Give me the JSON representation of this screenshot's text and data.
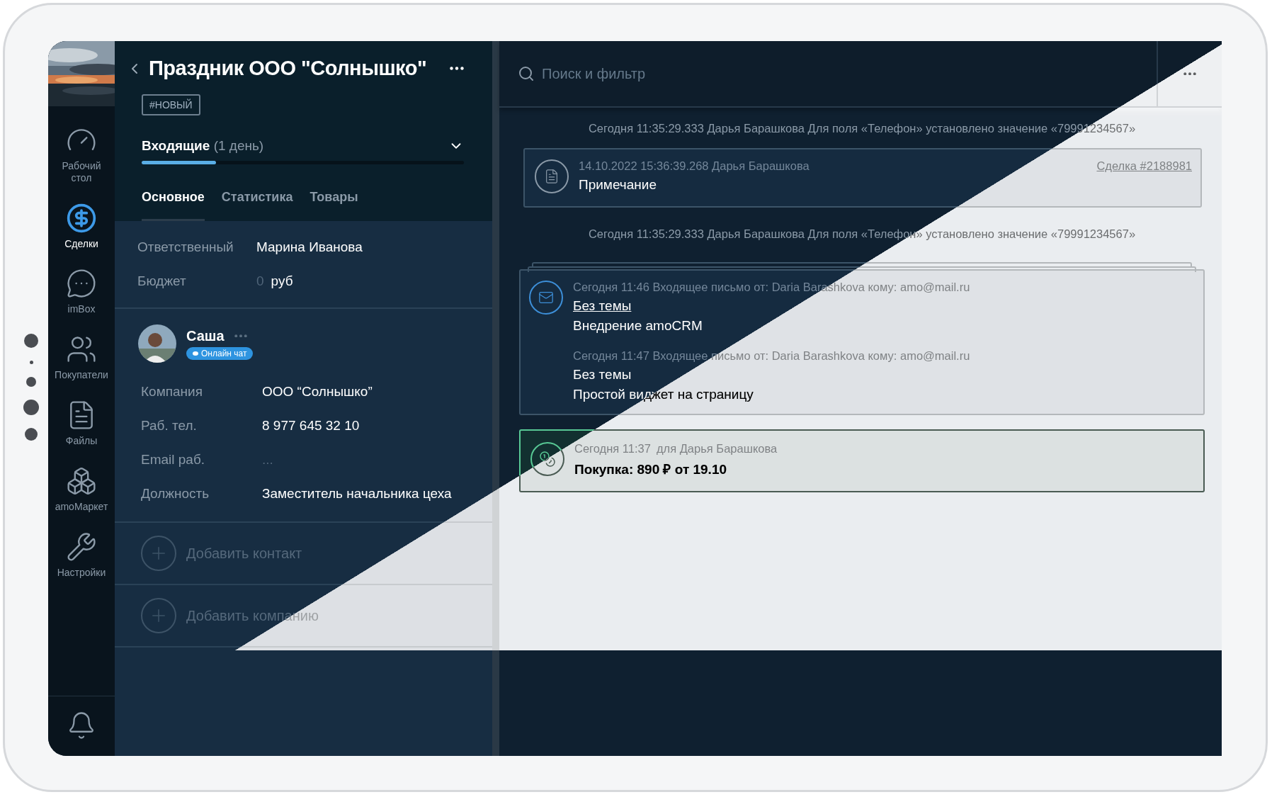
{
  "sidebar": {
    "items": [
      {
        "label": "Рабочий стол",
        "kind": "gauge",
        "selected": false
      },
      {
        "label": "Сделки",
        "kind": "deals",
        "selected": true
      },
      {
        "label": "imBox",
        "kind": "chat",
        "selected": false
      },
      {
        "label": "Покупатели",
        "kind": "customers",
        "selected": false
      },
      {
        "label": "Файлы",
        "kind": "files",
        "selected": false
      },
      {
        "label": "amoМаркет",
        "kind": "market",
        "selected": false
      },
      {
        "label": "Настройки",
        "kind": "settings",
        "selected": false
      }
    ]
  },
  "lead": {
    "title": "Праздник ООО \"Солнышко\"",
    "tag": "#НОВЫЙ",
    "pipeline": {
      "stage": "Входящие",
      "duration": "(1 день)",
      "level": 0.23
    },
    "tabs": [
      {
        "label": "Основное",
        "selected": true
      },
      {
        "label": "Статистика",
        "selected": false
      },
      {
        "label": "Товары",
        "selected": false
      }
    ],
    "fields": [
      {
        "label": "Ответственный",
        "value": "Марина Иванова",
        "kind": "text"
      },
      {
        "label": "Бюджет",
        "value": "0",
        "unit": "руб",
        "kind": "money"
      }
    ]
  },
  "contact": {
    "name": "Саша",
    "badge": "Онлайн чат",
    "fields": [
      {
        "label": "Компания",
        "value": "ООО “Солнышко”",
        "kind": "text"
      },
      {
        "label": "Раб. тел.",
        "value": "8 977 645 32 10",
        "kind": "text"
      },
      {
        "label": "Email раб.",
        "value": "...",
        "kind": "empty"
      },
      {
        "label": "Должность",
        "value": "Заместитель начальника цеха",
        "kind": "text"
      }
    ]
  },
  "add_actions": [
    "Добавить контакт",
    "Добавить компанию"
  ],
  "feed": {
    "search": {
      "placeholder": "Поиск и фильтр"
    },
    "events": [
      {
        "kind": "system",
        "text": "Сегодня 11:35:29.333 Дарья Барашкова Для поля «Телефон» установлено значение «79991234567»"
      },
      {
        "kind": "note",
        "meta": "14.10.2022 15:36:39.268 Дарья Барашкова",
        "link": "Сделка #2188981",
        "text": "Примечание"
      },
      {
        "kind": "system",
        "text": "Сегодня 11:35:29.333 Дарья Барашкова Для поля «Телефон» установлено значение «79991234567»"
      },
      {
        "kind": "mail",
        "messages": [
          {
            "meta": "Сегодня 11:46 Входящее письмо от: Daria Barashkova кому: amo@mail.ru",
            "subject": "Без темы",
            "underlined": true,
            "body": "Внедрение amoCRM"
          },
          {
            "meta": "Сегодня 11:47 Входящее письмо от: Daria Barashkova кому: amo@mail.ru",
            "subject": "Без темы",
            "underlined": false,
            "body": "Простой виджет на страницу"
          }
        ]
      },
      {
        "kind": "purchase",
        "time": "Сегодня 11:37",
        "meta": "для Дарья Барашкова",
        "text": "Покупка: 890 ₽ от 19.10"
      }
    ]
  }
}
